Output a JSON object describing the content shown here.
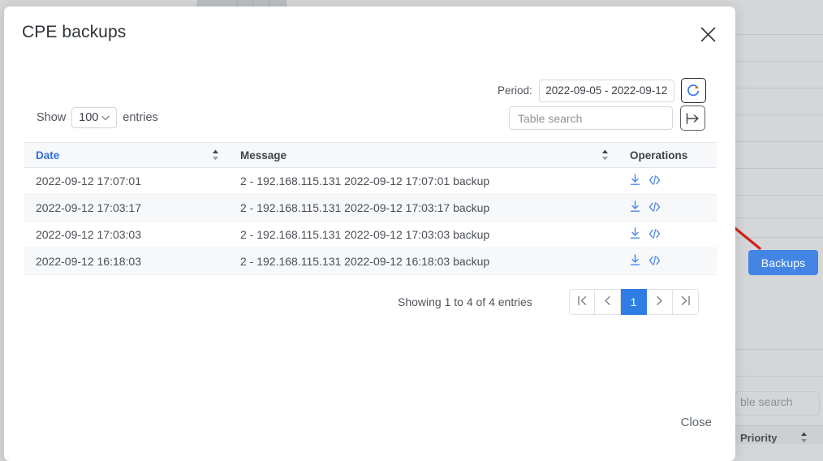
{
  "background": {
    "search_placeholder": "ble search",
    "priority_column": "Priority",
    "backups_button": "Backups",
    "overlay_color": "#d4d6d8",
    "accent_color": "#4285e4",
    "annotation_arrow_color": "#d0211c"
  },
  "modal": {
    "title": "CPE backups",
    "close_icon": "close-icon",
    "footer_close_label": "Close",
    "controls": {
      "period_label": "Period:",
      "period_value": "2022-09-05 - 2022-09-12",
      "refresh_icon": "refresh-icon",
      "show_label": "Show",
      "entries_value": "100",
      "entries_label": "entries",
      "search_placeholder": "Table search",
      "search_value": "",
      "export_icon": "export-icon"
    },
    "table": {
      "columns": [
        {
          "label": "Date",
          "sorted": true,
          "sortable": true
        },
        {
          "label": "Message",
          "sorted": false,
          "sortable": true
        },
        {
          "label": "Operations",
          "sorted": false,
          "sortable": false
        }
      ],
      "rows": [
        {
          "date": "2022-09-12 17:07:01",
          "message": "2 - 192.168.115.131 2022-09-12 17:07:01 backup",
          "operations": [
            "download-icon",
            "code-icon"
          ]
        },
        {
          "date": "2022-09-12 17:03:17",
          "message": "2 - 192.168.115.131 2022-09-12 17:03:17 backup",
          "operations": [
            "download-icon",
            "code-icon"
          ]
        },
        {
          "date": "2022-09-12 17:03:03",
          "message": "2 - 192.168.115.131 2022-09-12 17:03:03 backup",
          "operations": [
            "download-icon",
            "code-icon"
          ]
        },
        {
          "date": "2022-09-12 16:18:03",
          "message": "2 - 192.168.115.131 2022-09-12 16:18:03 backup",
          "operations": [
            "download-icon",
            "code-icon"
          ]
        }
      ]
    },
    "footer": {
      "showing_text": "Showing 1 to 4 of 4 entries",
      "pager": [
        {
          "label": "|<",
          "name": "first",
          "active": false
        },
        {
          "label": "<",
          "name": "prev",
          "active": false
        },
        {
          "label": "1",
          "name": "page-1",
          "active": true
        },
        {
          "label": ">",
          "name": "next",
          "active": false
        },
        {
          "label": ">|",
          "name": "last",
          "active": false
        }
      ]
    }
  }
}
